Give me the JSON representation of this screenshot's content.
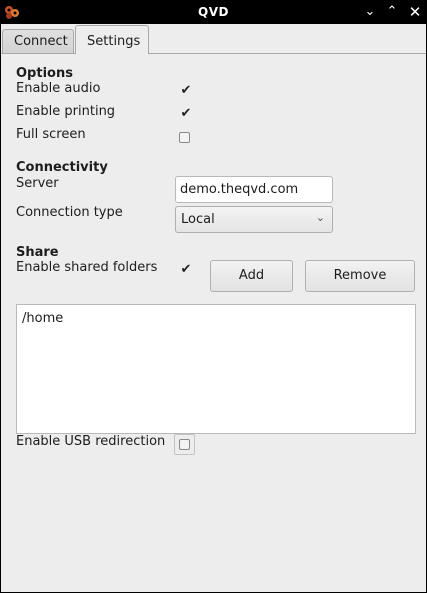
{
  "window": {
    "title": "QVD"
  },
  "titlebar": {
    "minimize_icon": "chevron-down-icon",
    "maximize_icon": "chevron-up-icon",
    "close_icon": "close-icon"
  },
  "tabs": [
    {
      "label": "Connect",
      "selected": false
    },
    {
      "label": "Settings",
      "selected": true
    }
  ],
  "options": {
    "title": "Options",
    "enable_audio": {
      "label": "Enable audio",
      "checked": true
    },
    "enable_printing": {
      "label": "Enable printing",
      "checked": true
    },
    "full_screen": {
      "label": "Full screen",
      "checked": false
    }
  },
  "connectivity": {
    "title": "Connectivity",
    "server": {
      "label": "Server",
      "value": "demo.theqvd.com"
    },
    "connection_type": {
      "label": "Connection type",
      "value": "Local"
    }
  },
  "share": {
    "title": "Share",
    "enable_shared_folders": {
      "label": "Enable shared folders",
      "checked": true
    },
    "add_label": "Add",
    "remove_label": "Remove",
    "folders": [
      "/home"
    ],
    "enable_usb": {
      "label": "Enable USB redirection",
      "checked": false
    }
  }
}
